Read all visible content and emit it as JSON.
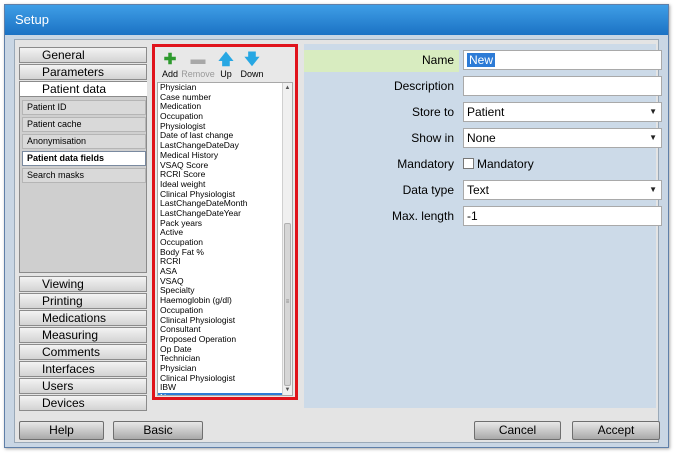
{
  "window": {
    "title": "Setup"
  },
  "nav": {
    "top_items": [
      "General",
      "Parameters",
      "Patient data"
    ],
    "sub_items": [
      "Patient ID",
      "Patient cache",
      "Anonymisation",
      "Patient data fields",
      "Search masks"
    ],
    "bottom_items": [
      "Viewing",
      "Printing",
      "Medications",
      "Measuring",
      "Comments",
      "Interfaces",
      "Users",
      "Devices"
    ]
  },
  "toolbar": {
    "add": {
      "label": "Add",
      "icon": "plus-icon",
      "color": "#2e9a2e"
    },
    "remove": {
      "label": "Remove",
      "icon": "minus-icon"
    },
    "up": {
      "label": "Up",
      "icon": "arrow-up-icon",
      "color": "#27a7e3"
    },
    "down": {
      "label": "Down",
      "icon": "arrow-down-icon",
      "color": "#27a7e3"
    }
  },
  "fields_list": [
    "Physician",
    "Case number",
    "Medication",
    "Occupation",
    "Physiologist",
    "Date of last change",
    "LastChangeDateDay",
    "Medical History",
    "VSAQ Score",
    "RCRI Score",
    "Ideal weight",
    "Clinical Physiologist",
    "LastChangeDateMonth",
    "LastChangeDateYear",
    "Pack years",
    "Active",
    "Occupation",
    "Body Fat %",
    "RCRI",
    "ASA",
    "VSAQ",
    "Specialty",
    "Haemoglobin (g/dl)",
    "Occupation",
    "Clinical Physiologist",
    "Consultant",
    "Proposed Operation",
    "Op Date",
    "Technician",
    "Physician",
    "Clinical Physiologist",
    "IBW",
    "New"
  ],
  "selected_field": "New",
  "form": {
    "name_label": "Name",
    "name_value": "New",
    "description_label": "Description",
    "description_value": "",
    "store_to_label": "Store to",
    "store_to_value": "Patient",
    "show_in_label": "Show in",
    "show_in_value": "None",
    "mandatory_label": "Mandatory",
    "mandatory_checkbox_label": "Mandatory",
    "data_type_label": "Data type",
    "data_type_value": "Text",
    "max_length_label": "Max. length",
    "max_length_value": "-1"
  },
  "buttons": {
    "help": "Help",
    "basic": "Basic",
    "cancel": "Cancel",
    "accept": "Accept"
  },
  "colors": {
    "title_bar": "#1b72c4",
    "highlight_box": "#e0131b",
    "selection": "#2d7bd6",
    "name_row": "#d8ecc0"
  }
}
